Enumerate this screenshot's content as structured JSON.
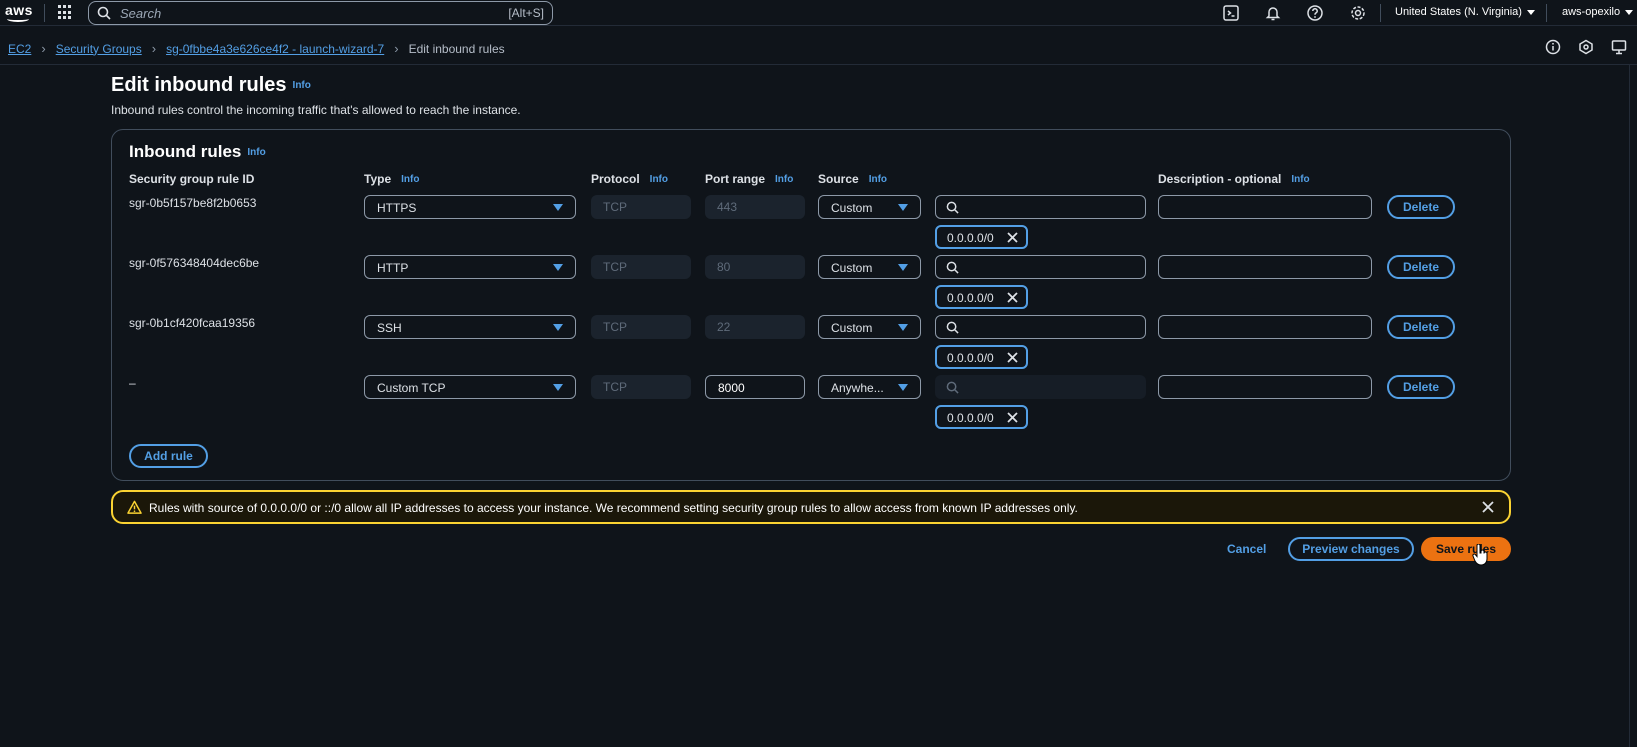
{
  "topnav": {
    "logo_text": "aws",
    "search_placeholder": "Search",
    "search_shortcut": "[Alt+S]",
    "region": "United States (N. Virginia)",
    "account": "aws-opexilo"
  },
  "breadcrumb": {
    "items": [
      "EC2",
      "Security Groups",
      "sg-0fbbe4a3e626ce4f2 - launch-wizard-7"
    ],
    "current": "Edit inbound rules"
  },
  "page": {
    "title": "Edit inbound rules",
    "info": "Info",
    "description": "Inbound rules control the incoming traffic that's allowed to reach the instance."
  },
  "rules_panel": {
    "title": "Inbound rules",
    "info": "Info",
    "columns": {
      "rule_id": "Security group rule ID",
      "type": "Type",
      "protocol": "Protocol",
      "port_range": "Port range",
      "source": "Source",
      "description": "Description - optional"
    },
    "rows": [
      {
        "id": "sgr-0b5f157be8f2b0653",
        "type": "HTTPS",
        "protocol": "TCP",
        "port": "443",
        "source": "Custom",
        "cidr": "0.0.0.0/0",
        "delete": "Delete"
      },
      {
        "id": "sgr-0f576348404dec6be",
        "type": "HTTP",
        "protocol": "TCP",
        "port": "80",
        "source": "Custom",
        "cidr": "0.0.0.0/0",
        "delete": "Delete"
      },
      {
        "id": "sgr-0b1cf420fcaa19356",
        "type": "SSH",
        "protocol": "TCP",
        "port": "22",
        "source": "Custom",
        "cidr": "0.0.0.0/0",
        "delete": "Delete"
      },
      {
        "id": "–",
        "type": "Custom TCP",
        "protocol": "TCP",
        "port": "8000",
        "source": "Anywhe...",
        "cidr": "0.0.0.0/0",
        "delete": "Delete"
      }
    ],
    "add_rule": "Add rule"
  },
  "alert": {
    "message": "Rules with source of 0.0.0.0/0 or ::/0 allow all IP addresses to access your instance. We recommend setting security group rules to allow access from known IP addresses only."
  },
  "footer": {
    "cancel": "Cancel",
    "preview": "Preview changes",
    "save": "Save rules"
  },
  "colors": {
    "accent": "#539fe5",
    "primary": "#ec7211",
    "warning": "#fbd332",
    "background": "#0f141a"
  }
}
